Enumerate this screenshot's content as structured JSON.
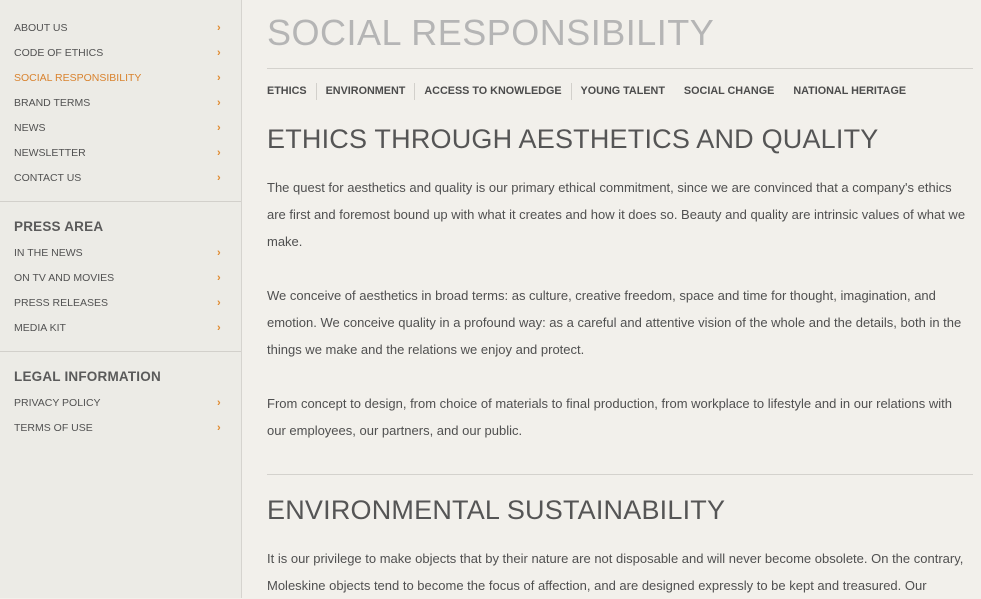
{
  "sidebar": {
    "main_items": [
      {
        "label": "ABOUT US"
      },
      {
        "label": "CODE OF ETHICS"
      },
      {
        "label": "SOCIAL RESPONSIBILITY",
        "active": true
      },
      {
        "label": "BRAND TERMS"
      },
      {
        "label": "NEWS"
      },
      {
        "label": "NEWSLETTER"
      },
      {
        "label": "CONTACT US"
      }
    ],
    "press": {
      "heading": "PRESS AREA",
      "items": [
        {
          "label": "IN THE NEWS"
        },
        {
          "label": "ON TV AND MOVIES"
        },
        {
          "label": "PRESS RELEASES"
        },
        {
          "label": "MEDIA KIT"
        }
      ]
    },
    "legal": {
      "heading": "LEGAL INFORMATION",
      "items": [
        {
          "label": "PRIVACY POLICY"
        },
        {
          "label": "TERMS OF USE"
        }
      ]
    },
    "chevron_icon": "chevron-right-icon"
  },
  "main": {
    "page_title": "SOCIAL RESPONSIBILITY",
    "tabs": [
      {
        "label": "ETHICS"
      },
      {
        "label": "ENVIRONMENT"
      },
      {
        "label": "ACCESS TO KNOWLEDGE"
      },
      {
        "label": "YOUNG TALENT"
      },
      {
        "label": "SOCIAL CHANGE"
      },
      {
        "label": "NATIONAL HERITAGE"
      }
    ],
    "sections": [
      {
        "title": "ETHICS THROUGH AESTHETICS AND QUALITY",
        "paragraphs": [
          "The quest for aesthetics and quality is our primary ethical commitment, since we are convinced that a company's ethics are first and foremost bound up with what it creates and how it does so. Beauty and quality are intrinsic values of what we make.",
          "We conceive of aesthetics in broad terms: as culture, creative freedom, space and time for thought, imagination, and emotion. We conceive quality in a profound way: as a careful and attentive vision of the whole and the details, both in the things we make and the relations we enjoy and protect.",
          "From concept to design, from choice of materials to final production, from workplace to lifestyle and in our relations with our employees, our partners, and our public."
        ]
      },
      {
        "title": "ENVIRONMENTAL SUSTAINABILITY",
        "paragraphs": [
          "It is our privilege to make objects that by their nature are not disposable and will never become obsolete. On the contrary, Moleskine objects tend to become the focus of affection, and are designed expressly to be kept and treasured. Our"
        ]
      }
    ]
  },
  "colors": {
    "accent": "#d9832f",
    "background": "#f2f0eb",
    "title_gray": "#b5b5b5",
    "text": "#505050"
  }
}
